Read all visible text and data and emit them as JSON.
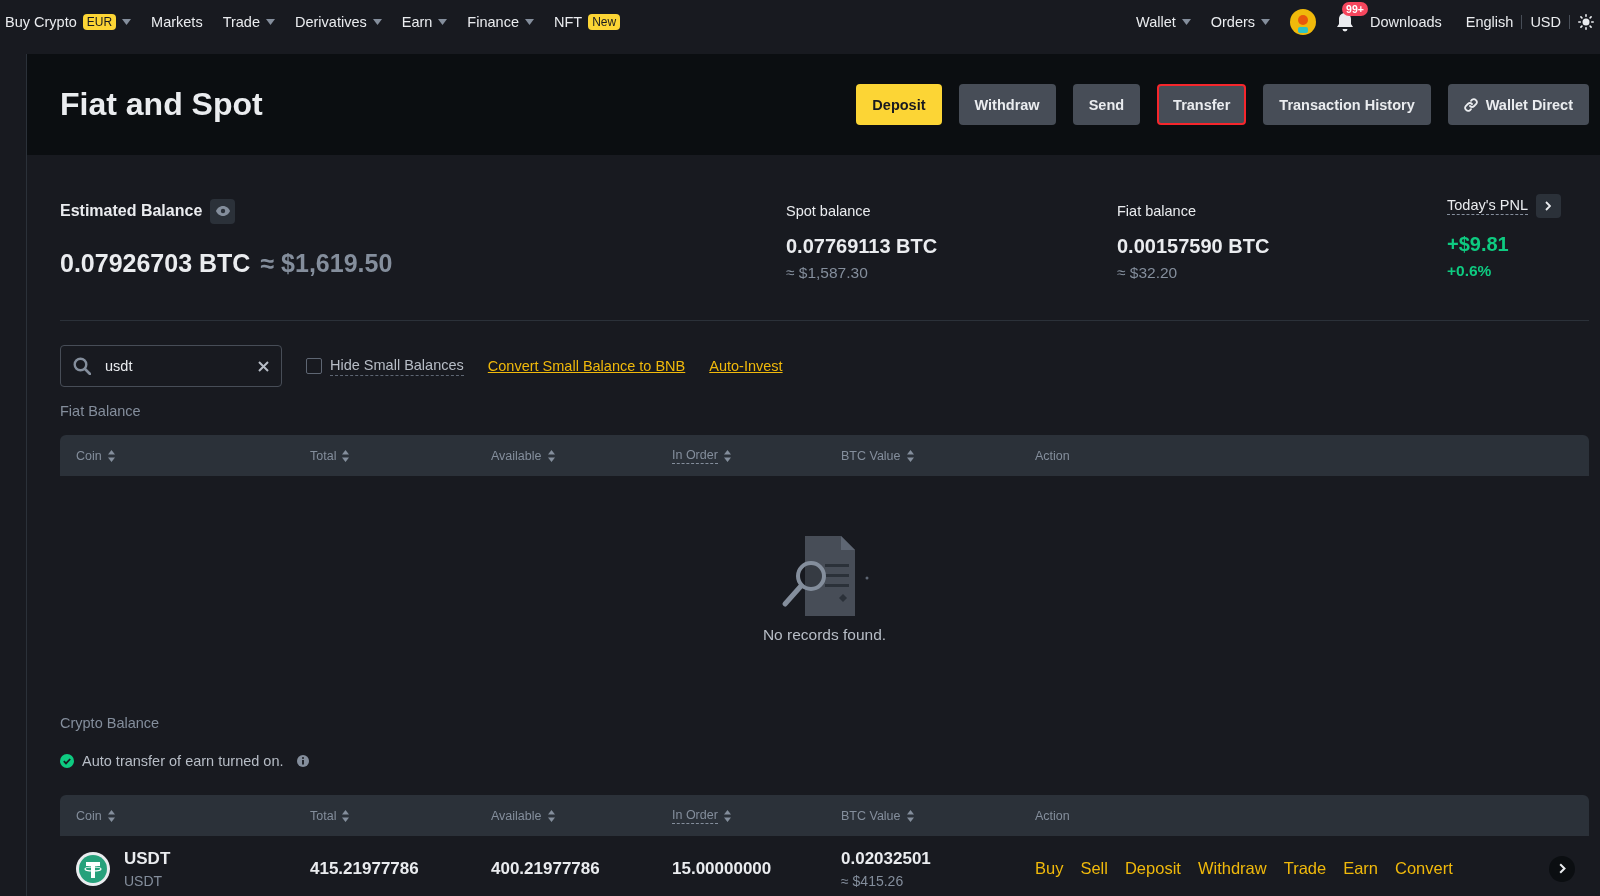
{
  "nav": {
    "left": [
      {
        "label": "Buy Crypto",
        "badge": "EUR",
        "dropdown": true
      },
      {
        "label": "Markets",
        "dropdown": false
      },
      {
        "label": "Trade",
        "dropdown": true
      },
      {
        "label": "Derivatives",
        "dropdown": true
      },
      {
        "label": "Earn",
        "dropdown": true
      },
      {
        "label": "Finance",
        "dropdown": true
      },
      {
        "label": "NFT",
        "badge": "New",
        "dropdown": false
      }
    ],
    "right": [
      {
        "label": "Wallet",
        "dropdown": true
      },
      {
        "label": "Orders",
        "dropdown": true
      }
    ],
    "notification_count": "99+",
    "links": [
      "Downloads",
      "English",
      "USD"
    ]
  },
  "header": {
    "title": "Fiat and Spot",
    "buttons": [
      {
        "label": "Deposit",
        "kind": "primary",
        "highlighted": false
      },
      {
        "label": "Withdraw",
        "kind": "secondary",
        "highlighted": false
      },
      {
        "label": "Send",
        "kind": "secondary",
        "highlighted": false
      },
      {
        "label": "Transfer",
        "kind": "secondary",
        "highlighted": true
      },
      {
        "label": "Transaction History",
        "kind": "secondary",
        "highlighted": false
      },
      {
        "label": "Wallet Direct",
        "kind": "link",
        "highlighted": false
      }
    ]
  },
  "balances": {
    "estimated": {
      "label": "Estimated Balance",
      "btc": "0.07926703 BTC",
      "usd": "≈ $1,619.50"
    },
    "spot": {
      "label": "Spot balance",
      "btc": "0.07769113 BTC",
      "usd": "≈ $1,587.30"
    },
    "fiat": {
      "label": "Fiat balance",
      "btc": "0.00157590 BTC",
      "usd": "≈ $32.20"
    },
    "pnl": {
      "label": "Today's PNL",
      "value": "+$9.81",
      "percent": "+0.6%"
    }
  },
  "filters": {
    "search": "usdt",
    "hide_small": {
      "label": "Hide Small Balances",
      "checked": false
    },
    "links": [
      "Convert Small Balance to BNB",
      "Auto-Invest"
    ]
  },
  "fiat_section": {
    "title": "Fiat Balance",
    "columns": [
      {
        "label": "Coin",
        "sortable": true,
        "tooltip": false
      },
      {
        "label": "Total",
        "sortable": true,
        "tooltip": false
      },
      {
        "label": "Available",
        "sortable": true,
        "tooltip": false
      },
      {
        "label": "In Order",
        "sortable": true,
        "tooltip": true
      },
      {
        "label": "BTC Value",
        "sortable": true,
        "tooltip": false
      },
      {
        "label": "Action",
        "sortable": false,
        "tooltip": false
      }
    ],
    "empty_text": "No records found."
  },
  "crypto_section": {
    "title": "Crypto Balance",
    "notice": "Auto transfer of earn turned on.",
    "columns": [
      {
        "label": "Coin",
        "sortable": true,
        "tooltip": false
      },
      {
        "label": "Total",
        "sortable": true,
        "tooltip": false
      },
      {
        "label": "Available",
        "sortable": true,
        "tooltip": false
      },
      {
        "label": "In Order",
        "sortable": true,
        "tooltip": true
      },
      {
        "label": "BTC Value",
        "sortable": true,
        "tooltip": false
      },
      {
        "label": "Action",
        "sortable": false,
        "tooltip": false
      }
    ],
    "rows": [
      {
        "coin": "USDT",
        "name": "USDT",
        "total": "415.21977786",
        "available": "400.21977786",
        "in_order": "15.00000000",
        "btc_value": "0.02032501",
        "usd_value": "≈ $415.26",
        "actions": [
          "Buy",
          "Sell",
          "Deposit",
          "Withdraw",
          "Trade",
          "Earn",
          "Convert"
        ]
      }
    ]
  }
}
